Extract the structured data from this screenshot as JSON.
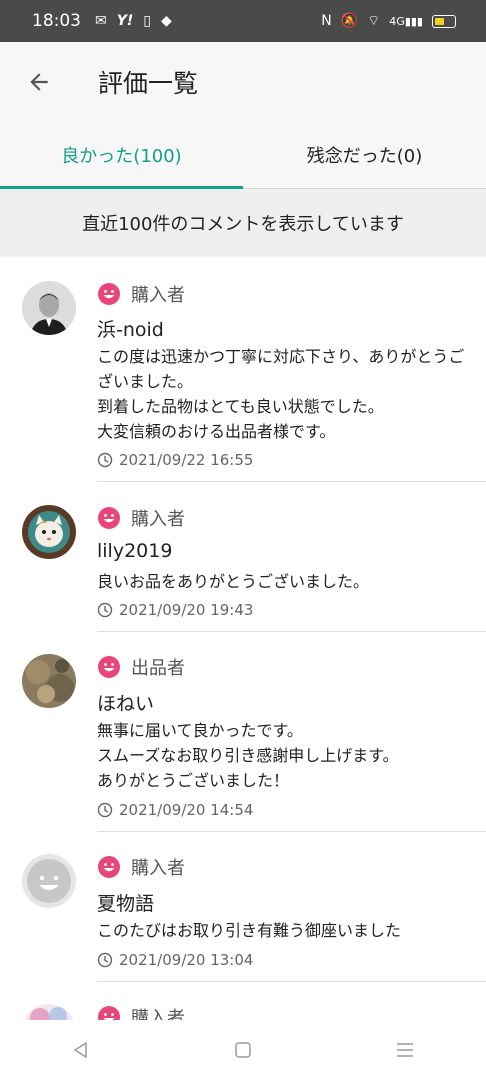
{
  "status_bar": {
    "time": "18:03",
    "left_icons": [
      "mail-icon",
      "yahoo-icon",
      "clipboard-icon",
      "tag-icon"
    ],
    "right_icons": [
      "nfc-icon",
      "mute-icon",
      "wifi-icon",
      "signal-icon",
      "battery-icon"
    ],
    "network": "4G"
  },
  "app_bar": {
    "title": "評価一覧"
  },
  "tabs": [
    {
      "label": "良かった(100)",
      "active": true
    },
    {
      "label": "残念だった(0)",
      "active": false
    }
  ],
  "banner": "直近100件のコメントを表示しています",
  "reviews": [
    {
      "role": "購入者",
      "name": "浜-noid",
      "comment": "この度は迅速かつ丁寧に対応下さり、ありがとうございました。\n到着した品物はとても良い状態でした。\n大変信頼のおける出品者様です。",
      "date": "2021/09/22 16:55"
    },
    {
      "role": "購入者",
      "name": "lily2019",
      "comment": "良いお品をありがとうございました。",
      "date": "2021/09/20 19:43"
    },
    {
      "role": "出品者",
      "name": "ほねい",
      "comment": "無事に届いて良かったです。\nスムーズなお取り引き感謝申し上げます。\nありがとうございました！",
      "date": "2021/09/20 14:54"
    },
    {
      "role": "購入者",
      "name": "夏物語",
      "comment": "このたびはお取り引き有難う御座いました",
      "date": "2021/09/20 13:04"
    },
    {
      "role": "購入者",
      "name": "",
      "comment": "",
      "date": ""
    }
  ],
  "colors": {
    "accent": "#13a08a",
    "smile": "#e8457a",
    "status_bar": "#4a4a4a"
  }
}
